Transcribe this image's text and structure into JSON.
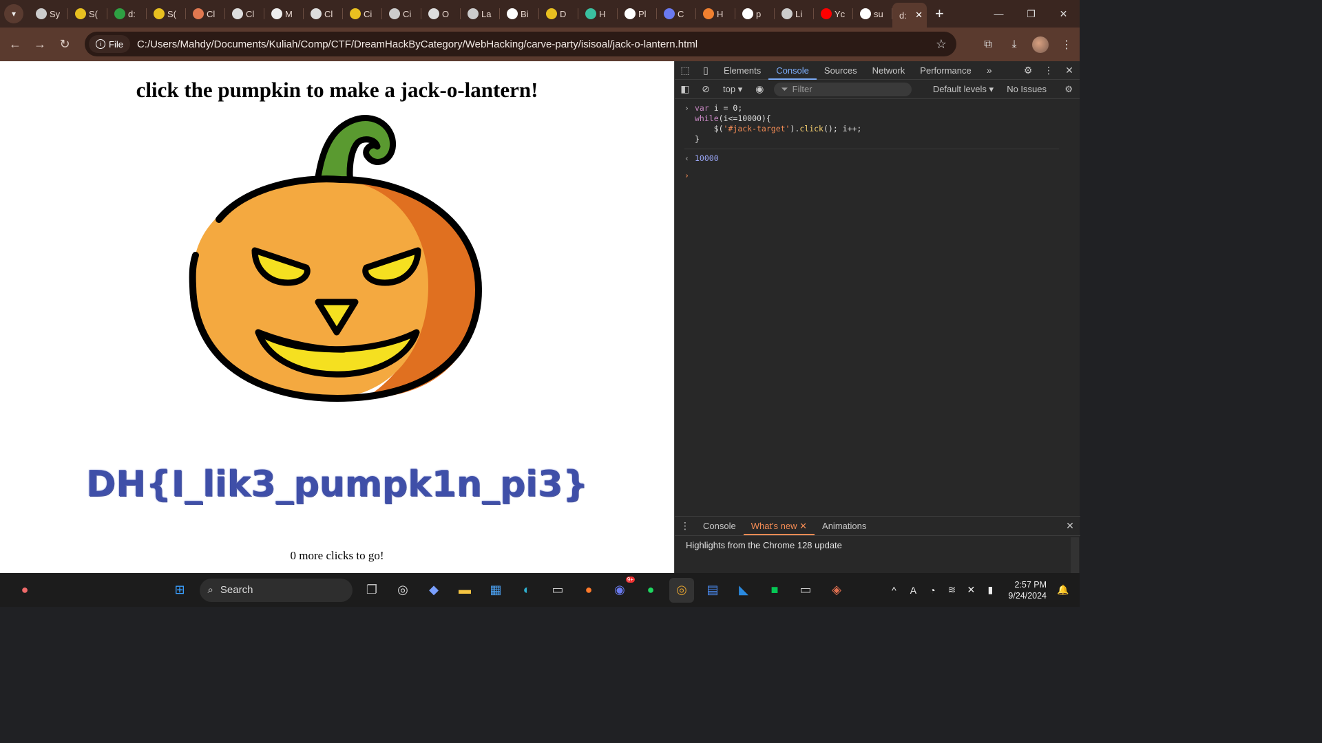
{
  "browser": {
    "tabs": [
      {
        "title": "Sy",
        "icon": "globe-icon"
      },
      {
        "title": "S(",
        "icon": "coin-icon"
      },
      {
        "title": "d:",
        "icon": "plus-app-icon"
      },
      {
        "title": "S(",
        "icon": "coin-icon"
      },
      {
        "title": "Cl",
        "icon": "claude-icon"
      },
      {
        "title": "Cl",
        "icon": "openai-icon"
      },
      {
        "title": "M",
        "icon": "m-icon"
      },
      {
        "title": "Cl",
        "icon": "openai-icon"
      },
      {
        "title": "Ci",
        "icon": "coin-icon"
      },
      {
        "title": "Ci",
        "icon": "globe-icon"
      },
      {
        "title": "O",
        "icon": "bird-icon"
      },
      {
        "title": "La",
        "icon": "globe-icon"
      },
      {
        "title": "Bi",
        "icon": "x-icon"
      },
      {
        "title": "D",
        "icon": "coin-icon"
      },
      {
        "title": "H",
        "icon": "gear-app-icon"
      },
      {
        "title": "Pl",
        "icon": "github-icon"
      },
      {
        "title": "C",
        "icon": "shield-icon"
      },
      {
        "title": "H",
        "icon": "stack-icon"
      },
      {
        "title": "p",
        "icon": "github-icon"
      },
      {
        "title": "Li",
        "icon": "globe-icon"
      },
      {
        "title": "Yc",
        "icon": "youtube-icon"
      },
      {
        "title": "su",
        "icon": "github-icon"
      }
    ],
    "active_tab": "d:",
    "file_chip": "File",
    "url": "C:/Users/Mahdy/Documents/Kuliah/Comp/CTF/DreamHackByCategory/WebHacking/carve-party/isisoal/jack-o-lantern.html"
  },
  "page": {
    "heading": "click the pumpkin to make a jack-o-lantern!",
    "flag": "DH{I_lik3_pumpk1n_pi3}",
    "clicks_remaining": "0 more clicks to go!"
  },
  "devtools": {
    "tabs": [
      "Elements",
      "Console",
      "Sources",
      "Network",
      "Performance"
    ],
    "active_tab": "Console",
    "context": "top",
    "filter_placeholder": "Filter",
    "levels": "Default levels",
    "issues": "No Issues",
    "code_lines": {
      "l1_kw": "var",
      "l1_rest": " i = 0;",
      "l2_kw": "while",
      "l2_rest": "(i<=10000){",
      "l3_a": "    $(",
      "l3_str": "'#jack-target'",
      "l3_b": ").",
      "l3_fn": "click",
      "l3_c": "(); i++;",
      "l4": "}"
    },
    "result": "10000",
    "drawer_tabs": [
      "Console",
      "What's new",
      "Animations"
    ],
    "drawer_active": "What's new",
    "drawer_text": "Highlights from the Chrome 128 update"
  },
  "taskbar": {
    "search_label": "Search",
    "time": "2:57 PM",
    "date": "9/24/2024",
    "discord_badge": "9+"
  },
  "colors": {
    "flag_color": "#3f4fa8",
    "pumpkin_main": "#f4a940",
    "pumpkin_shade": "#e07020",
    "stem": "#5a9a30",
    "face": "#f5e020"
  }
}
